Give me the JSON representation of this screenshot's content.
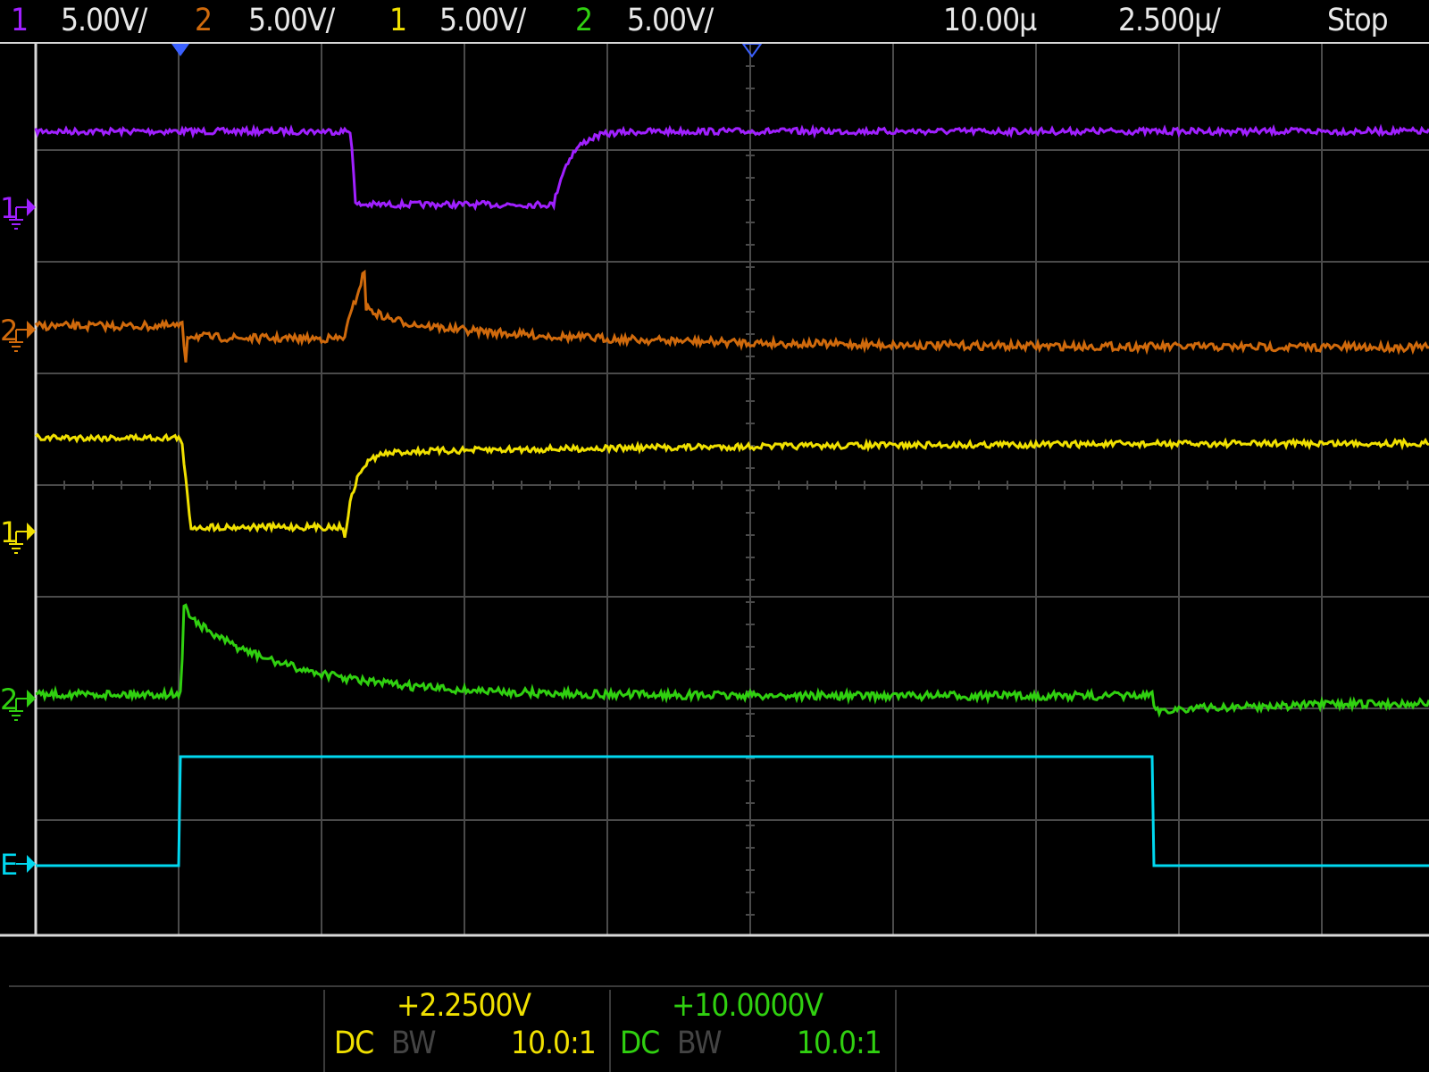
{
  "colors": {
    "ch1": "#a020ff",
    "ch2": "#d06a0c",
    "ch3": "#f0e000",
    "ch4": "#30d010",
    "ext": "#00d8f0",
    "text": "#e8e8e8",
    "grid": "#4a4a4a",
    "dim": "#444444"
  },
  "header": {
    "ch_a_num": "1",
    "ch_a_scale": "5.00V/",
    "ch_b_num": "2",
    "ch_b_scale": "5.00V/",
    "ch_c_num": "1",
    "ch_c_scale": "5.00V/",
    "ch_d_num": "2",
    "ch_d_scale": "5.00V/",
    "timebase": "10.00µ",
    "sample_rate": "2.500µ/",
    "run_state": "Stop"
  },
  "markers": [
    {
      "label": "1",
      "color_key": "ch1",
      "name": "ch1-ground-marker"
    },
    {
      "label": "2",
      "color_key": "ch2",
      "name": "ch2-ground-marker"
    },
    {
      "label": "1",
      "color_key": "ch3",
      "name": "ch3-ground-marker"
    },
    {
      "label": "2",
      "color_key": "ch4",
      "name": "ch4-ground-marker"
    },
    {
      "label": "E",
      "color_key": "ext",
      "name": "ext-marker"
    }
  ],
  "footer": {
    "offset_left": "+2.2500V",
    "offset_right": "+10.0000V",
    "coupling_left": "DC",
    "bw_left": "BW",
    "probe_left": "10.0:1",
    "coupling_right": "DC",
    "bw_right": "BW",
    "probe_right": "10.0:1"
  }
}
